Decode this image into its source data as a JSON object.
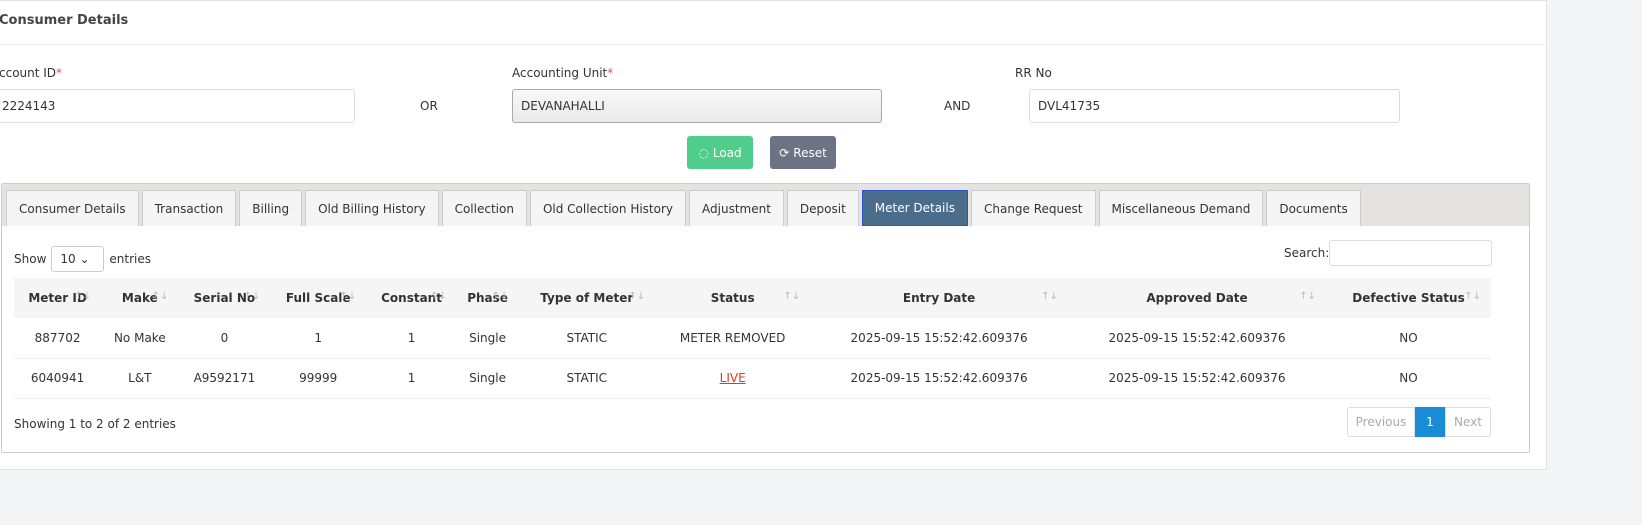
{
  "card_title": "Consumer Details",
  "form": {
    "account_id_label": "Account ID",
    "account_id_value": "2224143",
    "or_label": "OR",
    "accounting_unit_label": "Accounting Unit",
    "accounting_unit_value": "DEVANAHALLI",
    "and_label": "AND",
    "rr_no_label": "RR No",
    "rr_no_value": "DVL41735",
    "required_mark": "*",
    "load_label": "Load",
    "reset_label": "Reset"
  },
  "tabs": [
    "Consumer Details",
    "Transaction",
    "Billing",
    "Old Billing History",
    "Collection",
    "Old Collection History",
    "Adjustment",
    "Deposit",
    "Meter Details",
    "Change Request",
    "Miscellaneous Demand",
    "Documents"
  ],
  "active_tab": "Meter Details",
  "table_controls": {
    "show_label": "Show",
    "entries_value": "10",
    "entries_label": "entries",
    "search_label": "Search:"
  },
  "columns": [
    "Meter ID",
    "Make",
    "Serial No",
    "Full Scale",
    "Constant",
    "Phase",
    "Type of Meter",
    "Status",
    "Entry Date",
    "Approved Date",
    "Defective Status"
  ],
  "rows": [
    [
      "887702",
      "No Make",
      "0",
      "1",
      "1",
      "Single",
      "STATIC",
      "METER REMOVED",
      "2025-09-15 15:52:42.609376",
      "2025-09-15 15:52:42.609376",
      "NO"
    ],
    [
      "6040941",
      "L&T",
      "A9592171",
      "99999",
      "1",
      "Single",
      "STATIC",
      "LIVE",
      "2025-09-15 15:52:42.609376",
      "2025-09-15 15:52:42.609376",
      "NO"
    ]
  ],
  "footer": {
    "info": "Showing 1 to 2 of 2 entries",
    "previous": "Previous",
    "page": "1",
    "next": "Next"
  },
  "colors": {
    "load": "#4fce8b",
    "reset": "#6c7385",
    "active_tab": "#4a6d8c",
    "page_active": "#1a8bd6",
    "live": "#e03a1e"
  }
}
